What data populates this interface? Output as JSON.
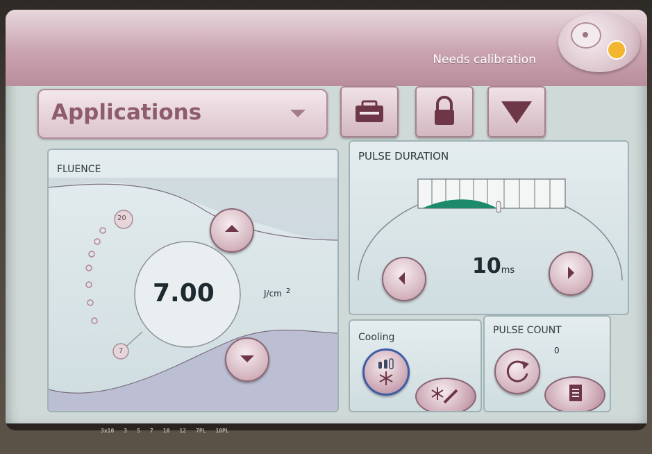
{
  "status": {
    "text": "Needs calibration"
  },
  "header": {
    "application_label": "Applications"
  },
  "toolbar": {
    "service_icon": "service-case-icon",
    "lock_icon": "lock-icon",
    "menu_icon": "down-triangle-icon"
  },
  "fluence": {
    "title": "FLUENCE",
    "value": "7.00",
    "unit": "J/cm",
    "unit_exp": "2",
    "scale_max": "20",
    "scale_min": "7"
  },
  "pulse_duration": {
    "title": "PULSE DURATION",
    "value": "10",
    "unit": "ms"
  },
  "cooling": {
    "title": "Cooling"
  },
  "pulse_count": {
    "title": "PULSE COUNT",
    "value": "0"
  },
  "footer_tabs": [
    "3x10",
    "3",
    "5",
    "7",
    "10",
    "12",
    "7PL",
    "10PL"
  ],
  "colors": {
    "accent": "#8e5c6d",
    "button_dark": "#6e3747",
    "gauge_green": "#1c8a6b",
    "logo_sun": "#f2b630"
  }
}
